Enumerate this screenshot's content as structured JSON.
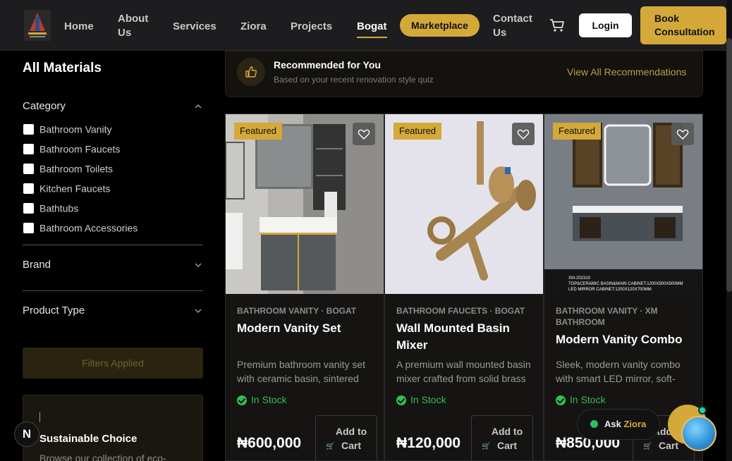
{
  "header": {
    "nav": [
      "Home",
      "About Us",
      "Services",
      "Ziora",
      "Projects",
      "Bogat"
    ],
    "active_nav": "Bogat",
    "marketplace_label": "Marketplace",
    "contact_label": "Contact Us",
    "login_label": "Login",
    "consult_label": "Book Consultation",
    "cart_icon": "cart-icon"
  },
  "sidebar": {
    "title": "All Materials",
    "category_label": "Category",
    "categories": [
      "Bathroom Vanity",
      "Bathroom Faucets",
      "Bathroom Toilets",
      "Kitchen Faucets",
      "Bathtubs",
      "Bathroom Accessories"
    ],
    "brand_label": "Brand",
    "product_type_label": "Product Type",
    "filters_applied": "Filters Applied",
    "sustainable_title": "Sustainable Choice",
    "sustainable_sub": "Browse our collection of eco-"
  },
  "recommend": {
    "title": "Recommended for You",
    "subtitle": "Based on your recent renovation style quiz",
    "link": "View All Recommendations"
  },
  "products": [
    {
      "badge": "Featured",
      "category": "BATHROOM VANITY · BOGAT",
      "name": "Modern Vanity Set",
      "desc": "Premium bathroom vanity set with ceramic basin, sintered stone top",
      "stock": "In Stock",
      "price": "₦600,000",
      "add_label": "Add to Cart"
    },
    {
      "badge": "Featured",
      "category": "BATHROOM FAUCETS · BOGAT",
      "name": "Wall Mounted Basin Mixer",
      "desc": "A premium wall mounted basin mixer crafted from solid brass",
      "stock": "In Stock",
      "price": "₦120,000",
      "add_label": "Add to Cart"
    },
    {
      "badge": "Featured",
      "category": "BATHROOM VANITY · XM BATHROOM",
      "name": "Modern Vanity Combo",
      "desc": "Sleek, modern vanity combo with smart LED mirror, soft-close drawers",
      "stock": "In Stock",
      "price": "₦850,000",
      "add_label": "Add to Cart",
      "img_caption_1": "XM-202310",
      "img_caption_2": "TOP&CERAMIC BASIN&MAIN CABINET:1200X500X500MM",
      "img_caption_3": "LED MIRROR CABINET:1200X120X700MM"
    }
  ],
  "chat": {
    "ask_label": "Ask",
    "ziora_label": "Ziora"
  },
  "badge_letter": "N",
  "colors": {
    "gold": "#d4a93a",
    "green": "#2fbf5a",
    "bg": "#000000"
  }
}
